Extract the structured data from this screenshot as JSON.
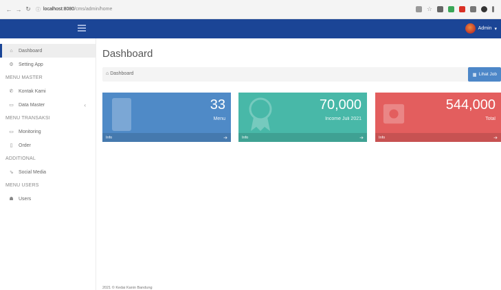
{
  "browser": {
    "url_host": "localhost:8080",
    "url_path": "/cms/admin/home",
    "back_icon": "arrow-left-icon",
    "forward_icon": "arrow-right-icon",
    "reload_icon": "reload-icon"
  },
  "header": {
    "user_label": "Admin",
    "user_caret": "▾"
  },
  "sidebar": {
    "items": [
      {
        "label": "Dashboard",
        "icon": "⌂",
        "active": true
      },
      {
        "label": "Setting App",
        "icon": "⚙"
      }
    ],
    "section_master": "MENU MASTER",
    "master_items": [
      {
        "label": "Kontak Kami",
        "icon": "✆"
      },
      {
        "label": "Data Master",
        "icon": "▭",
        "chevron": "‹"
      }
    ],
    "section_transaksi": "MENU TRANSAKSI",
    "transaksi_items": [
      {
        "label": "Monitoring",
        "icon": "▭"
      },
      {
        "label": "Order",
        "icon": "▯"
      }
    ],
    "section_additional": "ADDITIONAL",
    "additional_items": [
      {
        "label": "Social Media",
        "icon": "⇘"
      }
    ],
    "section_users": "MENU USERS",
    "users_items": [
      {
        "label": "Users",
        "icon": "☗"
      }
    ]
  },
  "main": {
    "title": "Dashboard",
    "breadcrumb": "Dashboard",
    "report_button": "Lihat Job"
  },
  "cards": [
    {
      "value": "33",
      "label": "Menu",
      "footer": "Info",
      "color": "#4f8ac7"
    },
    {
      "value": "70,000",
      "label": "Income Juli 2021",
      "footer": "Info",
      "color": "#48b8a8"
    },
    {
      "value": "544,000",
      "label": "Total",
      "footer": "Info",
      "color": "#e35e5e"
    }
  ],
  "footer": "2021 © Kedai Kanin Bandung"
}
